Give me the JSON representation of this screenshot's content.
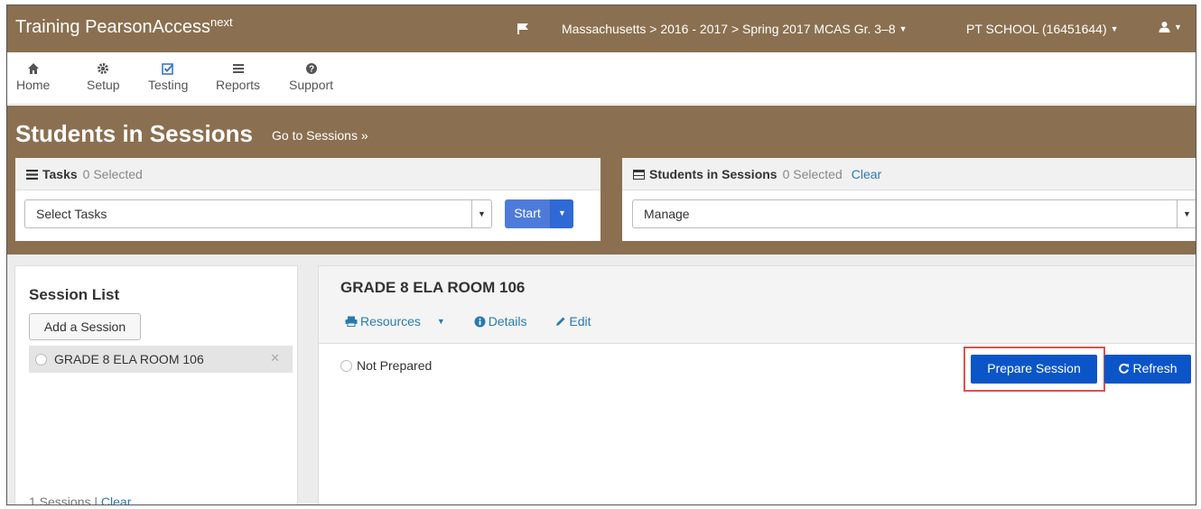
{
  "header": {
    "brand": "Training PearsonAccess",
    "brand_sup": "next",
    "breadcrumb": "Massachusetts > 2016 - 2017 > Spring 2017 MCAS Gr. 3–8",
    "school": "PT SCHOOL (16451644)"
  },
  "nav": [
    {
      "label": "Home",
      "icon": "home-icon"
    },
    {
      "label": "Setup",
      "icon": "gear-icon"
    },
    {
      "label": "Testing",
      "icon": "checkbox-icon"
    },
    {
      "label": "Reports",
      "icon": "list-icon"
    },
    {
      "label": "Support",
      "icon": "help-icon"
    }
  ],
  "page": {
    "title": "Students in Sessions",
    "go_link": "Go to Sessions »"
  },
  "tasks": {
    "label": "Tasks",
    "selected": "0 Selected",
    "select_value": "Select Tasks",
    "start_label": "Start"
  },
  "students": {
    "label": "Students in Sessions",
    "selected": "0 Selected",
    "clear": "Clear",
    "select_value": "Manage"
  },
  "session_list": {
    "title": "Session List",
    "add_button": "Add a Session",
    "items": [
      {
        "name": "GRADE 8 ELA ROOM 106"
      }
    ],
    "count_text": "1 Sessions",
    "separator": "|",
    "clear": "Clear"
  },
  "session": {
    "title": "GRADE 8 ELA ROOM 106",
    "resources": "Resources",
    "details": "Details",
    "edit": "Edit",
    "status": "Not Prepared",
    "prepare_button": "Prepare Session",
    "refresh_button": "Refresh"
  },
  "colors": {
    "brand": "#8a7050",
    "primary": "#0b55c8",
    "highlight": "#d9534f"
  }
}
